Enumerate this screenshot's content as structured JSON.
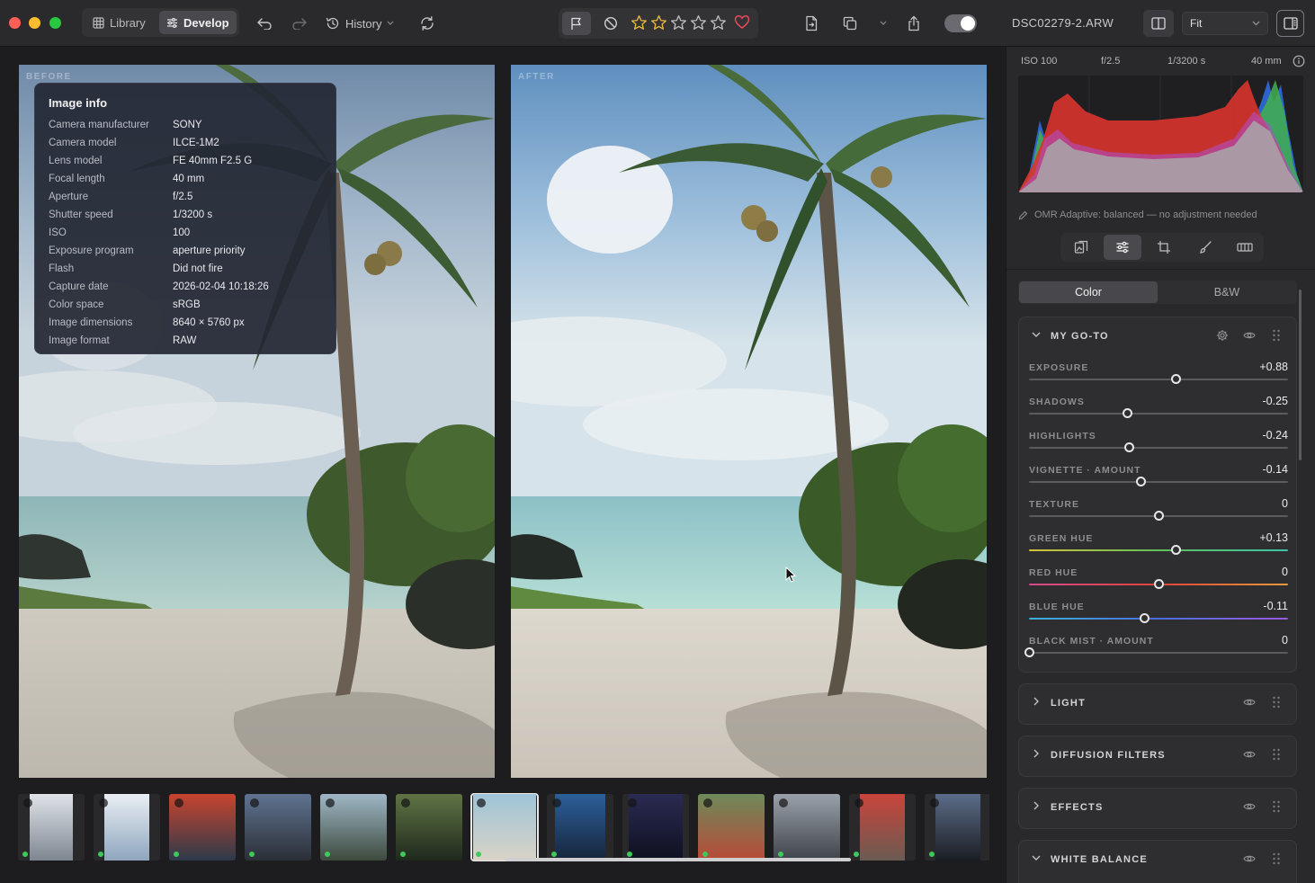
{
  "toolbar": {
    "library_label": "Library",
    "develop_label": "Develop",
    "history_label": "History",
    "filename": "DSC02279-2.ARW",
    "zoom_value": "Fit",
    "rating_stars": 2,
    "favorite": true,
    "colors": {
      "accent_star": "#e6b93f",
      "heart": "#e6495a"
    }
  },
  "viewer": {
    "before_label": "BEFORE",
    "after_label": "AFTER"
  },
  "image_info": {
    "title": "Image info",
    "rows": [
      {
        "key": "Camera manufacturer",
        "value": "SONY"
      },
      {
        "key": "Camera model",
        "value": "ILCE-1M2"
      },
      {
        "key": "Lens model",
        "value": "FE 40mm F2.5 G"
      },
      {
        "key": "Focal length",
        "value": "40 mm"
      },
      {
        "key": "Aperture",
        "value": "f/2.5"
      },
      {
        "key": "Shutter speed",
        "value": "1/3200 s"
      },
      {
        "key": "ISO",
        "value": "100"
      },
      {
        "key": "Exposure program",
        "value": "aperture priority"
      },
      {
        "key": "Flash",
        "value": "Did not fire"
      },
      {
        "key": "Capture date",
        "value": "2026-02-04 10:18:26"
      },
      {
        "key": "Color space",
        "value": "sRGB"
      },
      {
        "key": "Image dimensions",
        "value": "8640 × 5760 px"
      },
      {
        "key": "Image format",
        "value": "RAW"
      }
    ]
  },
  "exif_bar": {
    "iso": "ISO 100",
    "aperture": "f/2.5",
    "shutter": "1/3200 s",
    "focal": "40 mm"
  },
  "omr_status": "OMR Adaptive: balanced — no adjustment needed",
  "panel_tabs": {
    "color": "Color",
    "bw": "B&W"
  },
  "my_goto": {
    "title": "MY GO-TO",
    "sliders": [
      {
        "label": "EXPOSURE",
        "value": "+0.88",
        "position": 0.565,
        "track": "plain"
      },
      {
        "label": "SHADOWS",
        "value": "-0.25",
        "position": 0.38,
        "track": "plain"
      },
      {
        "label": "HIGHLIGHTS",
        "value": "-0.24",
        "position": 0.384,
        "track": "plain"
      },
      {
        "label": "VIGNETTE · AMOUNT",
        "value": "-0.14",
        "position": 0.43,
        "track": "plain"
      },
      {
        "label": "TEXTURE",
        "value": "0",
        "position": 0.5,
        "track": "plain"
      },
      {
        "label": "GREEN HUE",
        "value": "+0.13",
        "position": 0.565,
        "track": "green"
      },
      {
        "label": "RED HUE",
        "value": "0",
        "position": 0.5,
        "track": "red"
      },
      {
        "label": "BLUE HUE",
        "value": "-0.11",
        "position": 0.445,
        "track": "blue"
      },
      {
        "label": "BLACK MIST · AMOUNT",
        "value": "0",
        "position": 0.0,
        "track": "plain"
      }
    ]
  },
  "sections": [
    {
      "title": "LIGHT"
    },
    {
      "title": "DIFFUSION FILTERS"
    },
    {
      "title": "EFFECTS"
    },
    {
      "title": "WHITE BALANCE"
    }
  ],
  "filmstrip": {
    "selected_index": 6,
    "thumbs": [
      {
        "name": "cable-car-snow",
        "c1": "#dfe3e8",
        "c2": "#7d8691",
        "w": 48
      },
      {
        "name": "skier-snow",
        "c1": "#e9eef4",
        "c2": "#8fa6bd",
        "w": 50
      },
      {
        "name": "skis-rack",
        "c1": "#c8442f",
        "c2": "#2d3a4a",
        "w": 74
      },
      {
        "name": "street-evening",
        "c1": "#5f7391",
        "c2": "#2b2f36",
        "w": 74
      },
      {
        "name": "coast-cliff",
        "c1": "#9fb7c6",
        "c2": "#3d4a3e",
        "w": 74
      },
      {
        "name": "forest-path",
        "c1": "#5f7445",
        "c2": "#1f2a1d",
        "w": 74
      },
      {
        "name": "palm-beach",
        "c1": "#9ec4d8",
        "c2": "#d9d3c6",
        "w": 70
      },
      {
        "name": "blue-building",
        "c1": "#2c5f9a",
        "c2": "#16253a",
        "w": 56
      },
      {
        "name": "fireworks",
        "c1": "#2a2b52",
        "c2": "#0f1020",
        "w": 60
      },
      {
        "name": "red-car-field",
        "c1": "#6d8a5a",
        "c2": "#b94a38",
        "w": 74
      },
      {
        "name": "city-street",
        "c1": "#9aa1aa",
        "c2": "#3f434a",
        "w": 74
      },
      {
        "name": "red-lanterns",
        "c1": "#c9443b",
        "c2": "#6b5b52",
        "w": 50
      },
      {
        "name": "train-platform",
        "c1": "#5b6c88",
        "c2": "#1a1d24",
        "w": 50
      }
    ]
  }
}
